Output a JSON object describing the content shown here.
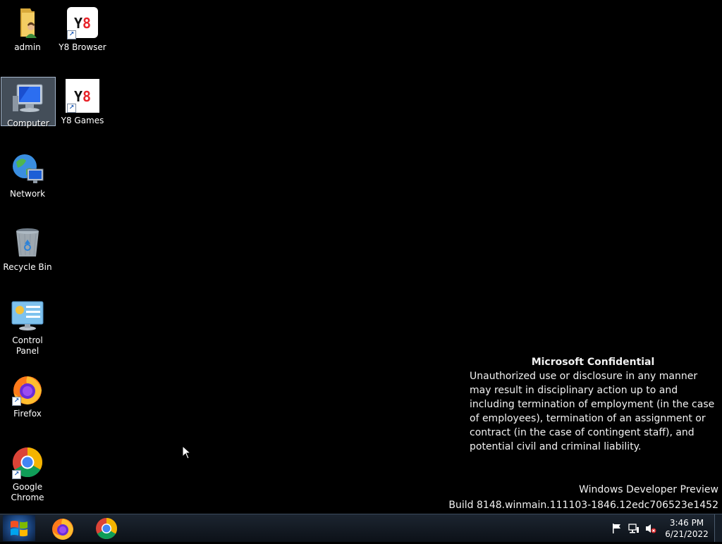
{
  "desktop": {
    "icons": [
      {
        "label": "admin"
      },
      {
        "label": "Y8 Browser"
      },
      {
        "label": "Computer"
      },
      {
        "label": "Y8 Games"
      },
      {
        "label": "Network"
      },
      {
        "label": "Recycle Bin"
      },
      {
        "label": "Control Panel"
      },
      {
        "label": "Firefox"
      },
      {
        "label": "Google Chrome"
      }
    ],
    "y8_logo_text": "Y8"
  },
  "watermark": {
    "title": "Microsoft Confidential",
    "body": "Unauthorized use or disclosure in any manner may result in disciplinary action up to and including termination of employment (in the case of employees), termination of an assignment or contract (in the case of contingent staff), and potential civil and criminal liability."
  },
  "build_info": {
    "line1": "Windows Developer Preview",
    "line2": "Build 8148.winmain.111103-1846.12edc706523e1452"
  },
  "taskbar": {
    "pinned": [
      "firefox-icon",
      "chrome-icon"
    ],
    "tray_icons": [
      "action-center-flag-icon",
      "network-icon",
      "volume-muted-icon"
    ],
    "time": "3:46 PM",
    "date": "6/21/2022"
  }
}
